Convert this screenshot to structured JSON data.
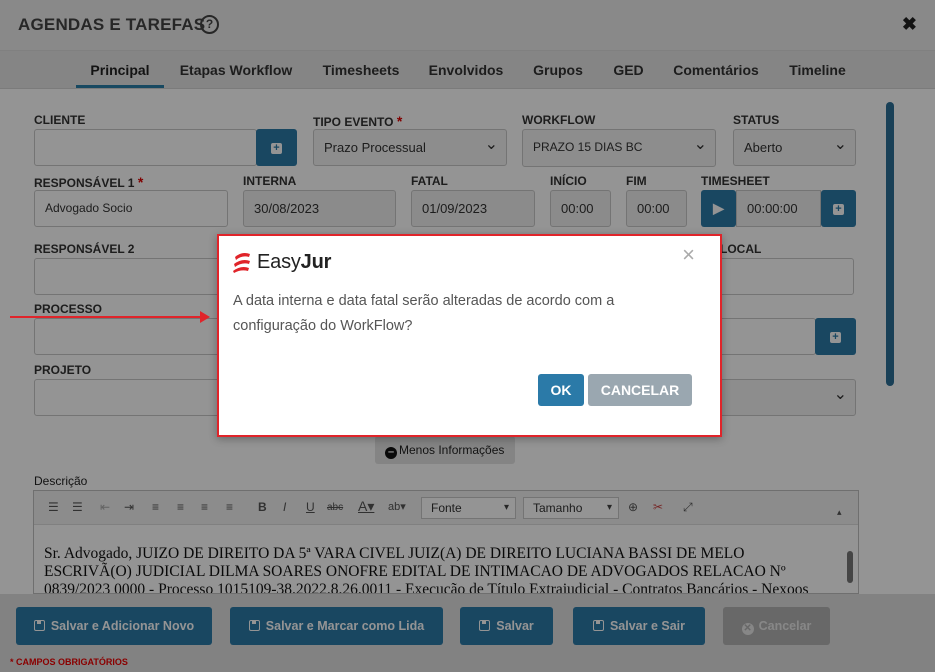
{
  "header": {
    "title": "AGENDAS E TAREFAS",
    "help_glyph": "?",
    "close_glyph": "✖"
  },
  "tabs": [
    {
      "label": "Principal",
      "active": true
    },
    {
      "label": "Etapas Workflow"
    },
    {
      "label": "Timesheets"
    },
    {
      "label": "Envolvidos"
    },
    {
      "label": "Grupos"
    },
    {
      "label": "GED"
    },
    {
      "label": "Comentários"
    },
    {
      "label": "Timeline"
    }
  ],
  "form": {
    "cliente_label": "CLIENTE",
    "cliente_value": "",
    "tipo_evento_label": "TIPO EVENTO",
    "tipo_evento_value": "Prazo Processual",
    "workflow_label": "WORKFLOW",
    "workflow_value": "PRAZO 15 DIAS BC",
    "status_label": "STATUS",
    "status_value": "Aberto",
    "responsavel1_label": "RESPONSÁVEL 1",
    "responsavel1_value": "Advogado Socio",
    "interna_label": "INTERNA",
    "interna_value": "30/08/2023",
    "fatal_label": "FATAL",
    "fatal_value": "01/09/2023",
    "inicio_label": "INÍCIO",
    "inicio_value": "00:00",
    "fim_label": "FIM",
    "fim_value": "00:00",
    "timesheet_label": "TIMESHEET",
    "timesheet_value": "00:00:00",
    "responsavel2_label": "RESPONSÁVEL 2",
    "local_label": "LOCAL",
    "processo_label": "PROCESSO",
    "projeto_label": "PROJETO",
    "required_mark": "*",
    "menos_label": "Menos Informações"
  },
  "editor": {
    "label": "Descrição",
    "font_select": "Fonte",
    "size_select": "Tamanho",
    "text": "Sr. Advogado, JUIZO DE DIREITO DA 5ª VARA CIVEL JUIZ(A) DE DIREITO LUCIANA BASSI DE MELO ESCRIVÃ(O) JUDICIAL DILMA SOARES ONOFRE EDITAL DE INTIMACAO DE ADVOGADOS RELACAO Nº 0839/2023 0000 - Processo 1015109-38.2022.8.26.0011 - Execução de Título Extrajudicial - Contratos Bancários - Nexoos"
  },
  "footer": {
    "btn_salvar_novo": "Salvar e Adicionar Novo",
    "btn_salvar_lida": "Salvar e Marcar como Lida",
    "btn_salvar": "Salvar",
    "btn_salvar_sair": "Salvar e Sair",
    "btn_cancelar": "Cancelar",
    "mandatory_note": "* CAMPOS OBRIGATÓRIOS"
  },
  "dialog": {
    "logo_text_light": "Easy",
    "logo_text_bold": "Jur",
    "message": "A data interna e data fatal serão alteradas de acordo com a configuração do WorkFlow?",
    "ok_label": "OK",
    "cancel_label": "CANCELAR",
    "close_glyph": "×"
  },
  "colors": {
    "accent": "#2b7aa8",
    "highlight": "#e0242a",
    "disabled": "#b3b3b3"
  }
}
